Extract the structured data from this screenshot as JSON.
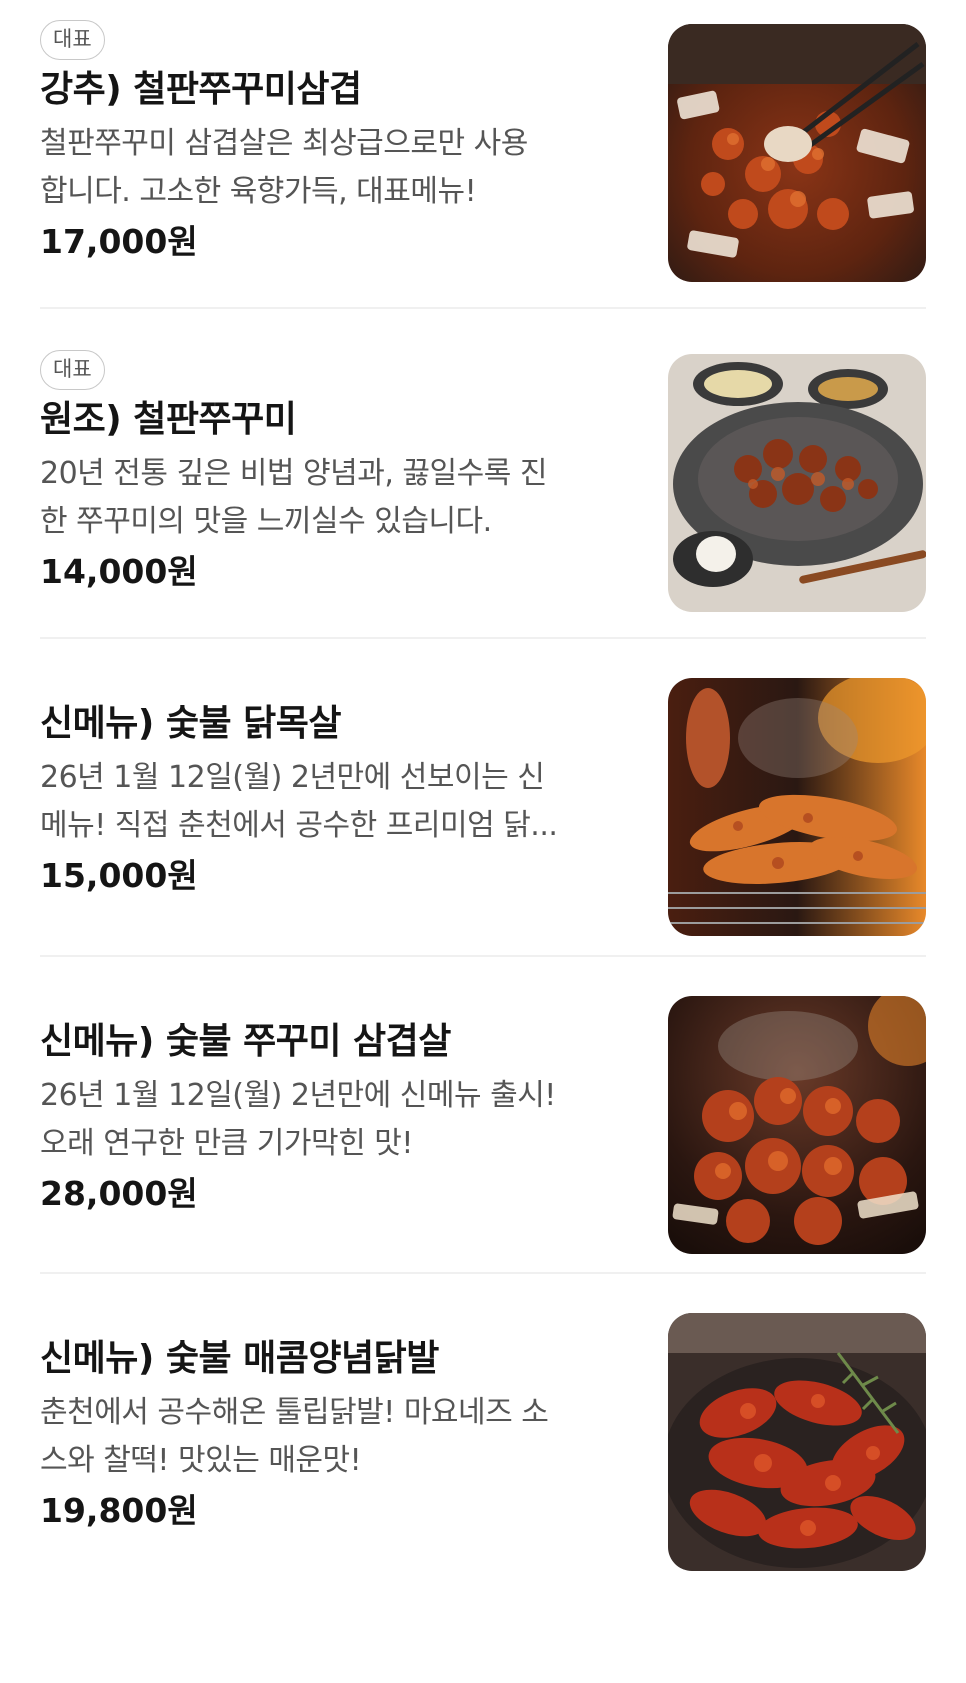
{
  "items": [
    {
      "badge": "대표",
      "name": "강추) 철판쭈꾸미삼겹",
      "desc_line1": "철판쭈꾸미 삼겹살은 최상급으로만 사용",
      "desc_line2": "합니다. 고소한 육향가득, 대표메뉴!",
      "price": "17,000원",
      "image_icon": "grilled-squid-pork-belly-photo"
    },
    {
      "badge": "대표",
      "name": "원조) 철판쭈꾸미",
      "desc_line1": "20년 전통 깊은 비법 양념과, 끓일수록 진",
      "desc_line2": "한 쭈꾸미의 맛을 느끼실수 있습니다.",
      "price": "14,000원",
      "image_icon": "iron-plate-squid-photo"
    },
    {
      "name": "신메뉴) 숯불 닭목살",
      "desc_line1": "26년 1월 12일(월) 2년만에 선보이는 신",
      "desc_line2": "메뉴! 직접 춘천에서 공수한 프리미엄 닭...",
      "price": "15,000원",
      "image_icon": "charcoal-chicken-neck-photo"
    },
    {
      "name": "신메뉴) 숯불 쭈꾸미 삼겹살",
      "desc_line1": "26년 1월 12일(월) 2년만에 신메뉴 출시!",
      "desc_line2": "오래 연구한 만큼 기가막힌 맛!",
      "price": "28,000원",
      "image_icon": "charcoal-squid-pork-belly-photo"
    },
    {
      "name": "신메뉴) 숯불 매콤양념닭발",
      "desc_line1": "춘천에서 공수해온 툴립닭발! 마요네즈 소",
      "desc_line2": "스와 찰떡! 맛있는 매운맛!",
      "price": "19,800원",
      "image_icon": "spicy-chicken-feet-photo"
    }
  ],
  "colors": {
    "text_primary": "#151515",
    "text_secondary": "#555555",
    "badge_border": "#c8c8c8",
    "divider": "#f0f0f0"
  }
}
